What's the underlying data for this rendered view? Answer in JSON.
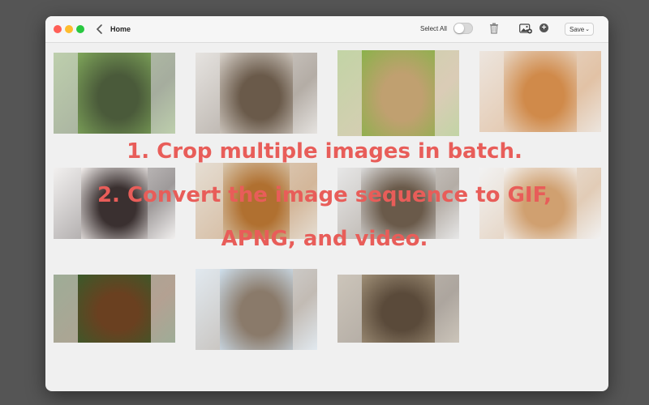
{
  "window": {
    "title": "Home",
    "back_icon": "chevron-left-icon"
  },
  "toolbar": {
    "select_all_label": "Select All",
    "select_all_on": false,
    "trash_icon": "trash-icon",
    "add_image_icon": "add-image-icon",
    "add_icon": "plus-circle-icon",
    "save_label": "Save",
    "save_chevron": "⌄"
  },
  "overlay": {
    "line1": "1. Crop multiple images in batch.",
    "line2": "2. Convert the image sequence to GIF,",
    "line3": "APNG, and video."
  },
  "photos": [
    {
      "name": "cat-and-puppy-on-grass",
      "colors": [
        "#7fa65a",
        "#4a5a3a"
      ]
    },
    {
      "name": "puppy-and-kitten-lying",
      "colors": [
        "#d9d3cc",
        "#6a5a4a"
      ]
    },
    {
      "name": "kitten-and-puppy-in-park",
      "colors": [
        "#8ab24a",
        "#c0a070"
      ]
    },
    {
      "name": "orange-cat-and-dog",
      "colors": [
        "#e8d8c8",
        "#d08a4a"
      ]
    },
    {
      "name": "black-white-bulldog",
      "colors": [
        "#f4f0ee",
        "#3a3030"
      ]
    },
    {
      "name": "golden-retriever-with-kitten",
      "colors": [
        "#d8c8b0",
        "#b07030"
      ]
    },
    {
      "name": "dog-and-cat-on-floor",
      "colors": [
        "#dcdcdc",
        "#6a5a4a"
      ]
    },
    {
      "name": "puppy-lying-on-white",
      "colors": [
        "#f4f4f4",
        "#d0a070"
      ]
    },
    {
      "name": "dachshund-and-kitten",
      "colors": [
        "#3a5a2a",
        "#6a4020"
      ]
    },
    {
      "name": "dog-in-blanket-snow",
      "colors": [
        "#cfe0ee",
        "#8a7a6a"
      ]
    },
    {
      "name": "dog-and-tabby-cat",
      "colors": [
        "#a09078",
        "#5a4a3a"
      ]
    }
  ]
}
